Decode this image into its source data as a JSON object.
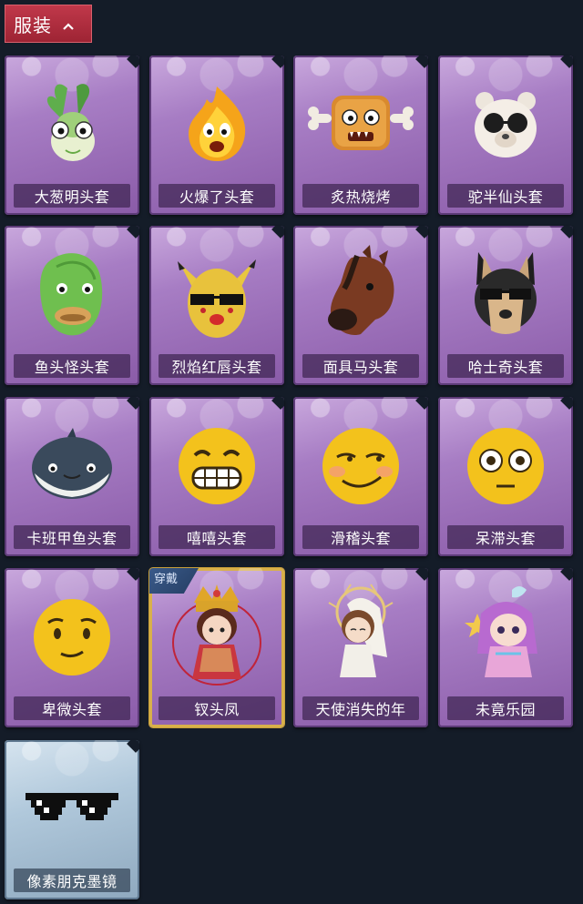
{
  "header": {
    "title": "服装",
    "toggle_icon": "chevron-up-icon"
  },
  "costumes": [
    {
      "name": "大葱明头套",
      "icon": "scallion-head-icon"
    },
    {
      "name": "火爆了头套",
      "icon": "fire-head-icon"
    },
    {
      "name": "炙热烧烤",
      "icon": "bbq-meat-head-icon"
    },
    {
      "name": "驼半仙头套",
      "icon": "alpaca-sunglasses-head-icon"
    },
    {
      "name": "鱼头怪头套",
      "icon": "fish-head-icon"
    },
    {
      "name": "烈焰红唇头套",
      "icon": "pikachu-mask-head-icon"
    },
    {
      "name": "面具马头套",
      "icon": "horse-mask-head-icon"
    },
    {
      "name": "哈士奇头套",
      "icon": "husky-head-icon"
    },
    {
      "name": "卡班甲鱼头套",
      "icon": "whale-head-icon"
    },
    {
      "name": "嘻嘻头套",
      "icon": "grin-emoji-head-icon"
    },
    {
      "name": "滑稽头套",
      "icon": "smirk-emoji-head-icon"
    },
    {
      "name": "呆滞头套",
      "icon": "dazed-emoji-head-icon"
    },
    {
      "name": "卑微头套",
      "icon": "humble-emoji-head-icon"
    },
    {
      "name": "钗头凤",
      "icon": "phoenix-crown-outfit-icon",
      "badge": "穿戴"
    },
    {
      "name": "天使消失的年",
      "icon": "angel-outfit-icon"
    },
    {
      "name": "未竟乐园",
      "icon": "wonderland-outfit-icon"
    },
    {
      "name": "像素朋克墨镜",
      "icon": "pixel-sunglasses-icon"
    }
  ],
  "colors": {
    "background": "#141c28",
    "tab": "#b02e3f",
    "card_purple": "#a77dc4",
    "card_blue": "#b0c8db",
    "worn_badge": "#2f4c77"
  }
}
